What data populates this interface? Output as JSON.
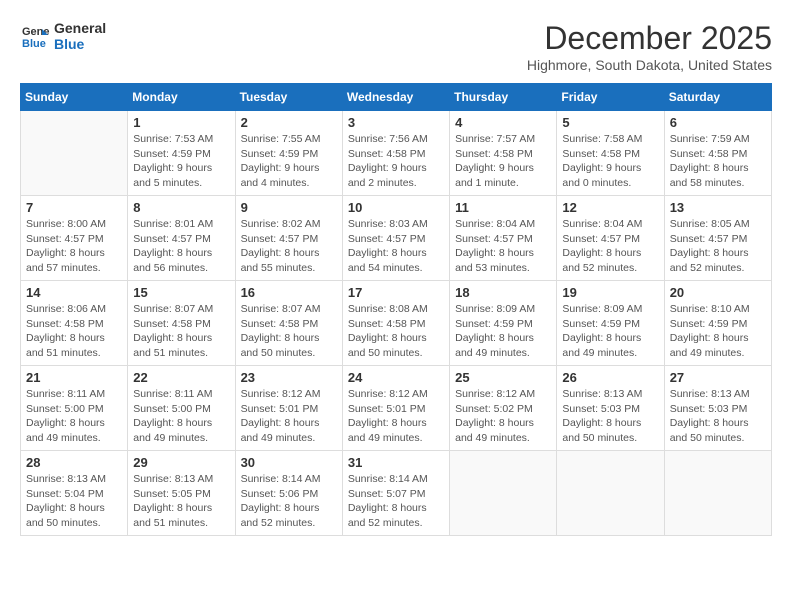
{
  "logo": {
    "line1": "General",
    "line2": "Blue"
  },
  "header": {
    "month": "December 2025",
    "location": "Highmore, South Dakota, United States"
  },
  "weekdays": [
    "Sunday",
    "Monday",
    "Tuesday",
    "Wednesday",
    "Thursday",
    "Friday",
    "Saturday"
  ],
  "weeks": [
    [
      {
        "day": "",
        "content": ""
      },
      {
        "day": "1",
        "content": "Sunrise: 7:53 AM\nSunset: 4:59 PM\nDaylight: 9 hours\nand 5 minutes."
      },
      {
        "day": "2",
        "content": "Sunrise: 7:55 AM\nSunset: 4:59 PM\nDaylight: 9 hours\nand 4 minutes."
      },
      {
        "day": "3",
        "content": "Sunrise: 7:56 AM\nSunset: 4:58 PM\nDaylight: 9 hours\nand 2 minutes."
      },
      {
        "day": "4",
        "content": "Sunrise: 7:57 AM\nSunset: 4:58 PM\nDaylight: 9 hours\nand 1 minute."
      },
      {
        "day": "5",
        "content": "Sunrise: 7:58 AM\nSunset: 4:58 PM\nDaylight: 9 hours\nand 0 minutes."
      },
      {
        "day": "6",
        "content": "Sunrise: 7:59 AM\nSunset: 4:58 PM\nDaylight: 8 hours\nand 58 minutes."
      }
    ],
    [
      {
        "day": "7",
        "content": "Sunrise: 8:00 AM\nSunset: 4:57 PM\nDaylight: 8 hours\nand 57 minutes."
      },
      {
        "day": "8",
        "content": "Sunrise: 8:01 AM\nSunset: 4:57 PM\nDaylight: 8 hours\nand 56 minutes."
      },
      {
        "day": "9",
        "content": "Sunrise: 8:02 AM\nSunset: 4:57 PM\nDaylight: 8 hours\nand 55 minutes."
      },
      {
        "day": "10",
        "content": "Sunrise: 8:03 AM\nSunset: 4:57 PM\nDaylight: 8 hours\nand 54 minutes."
      },
      {
        "day": "11",
        "content": "Sunrise: 8:04 AM\nSunset: 4:57 PM\nDaylight: 8 hours\nand 53 minutes."
      },
      {
        "day": "12",
        "content": "Sunrise: 8:04 AM\nSunset: 4:57 PM\nDaylight: 8 hours\nand 52 minutes."
      },
      {
        "day": "13",
        "content": "Sunrise: 8:05 AM\nSunset: 4:57 PM\nDaylight: 8 hours\nand 52 minutes."
      }
    ],
    [
      {
        "day": "14",
        "content": "Sunrise: 8:06 AM\nSunset: 4:58 PM\nDaylight: 8 hours\nand 51 minutes."
      },
      {
        "day": "15",
        "content": "Sunrise: 8:07 AM\nSunset: 4:58 PM\nDaylight: 8 hours\nand 51 minutes."
      },
      {
        "day": "16",
        "content": "Sunrise: 8:07 AM\nSunset: 4:58 PM\nDaylight: 8 hours\nand 50 minutes."
      },
      {
        "day": "17",
        "content": "Sunrise: 8:08 AM\nSunset: 4:58 PM\nDaylight: 8 hours\nand 50 minutes."
      },
      {
        "day": "18",
        "content": "Sunrise: 8:09 AM\nSunset: 4:59 PM\nDaylight: 8 hours\nand 49 minutes."
      },
      {
        "day": "19",
        "content": "Sunrise: 8:09 AM\nSunset: 4:59 PM\nDaylight: 8 hours\nand 49 minutes."
      },
      {
        "day": "20",
        "content": "Sunrise: 8:10 AM\nSunset: 4:59 PM\nDaylight: 8 hours\nand 49 minutes."
      }
    ],
    [
      {
        "day": "21",
        "content": "Sunrise: 8:11 AM\nSunset: 5:00 PM\nDaylight: 8 hours\nand 49 minutes."
      },
      {
        "day": "22",
        "content": "Sunrise: 8:11 AM\nSunset: 5:00 PM\nDaylight: 8 hours\nand 49 minutes."
      },
      {
        "day": "23",
        "content": "Sunrise: 8:12 AM\nSunset: 5:01 PM\nDaylight: 8 hours\nand 49 minutes."
      },
      {
        "day": "24",
        "content": "Sunrise: 8:12 AM\nSunset: 5:01 PM\nDaylight: 8 hours\nand 49 minutes."
      },
      {
        "day": "25",
        "content": "Sunrise: 8:12 AM\nSunset: 5:02 PM\nDaylight: 8 hours\nand 49 minutes."
      },
      {
        "day": "26",
        "content": "Sunrise: 8:13 AM\nSunset: 5:03 PM\nDaylight: 8 hours\nand 50 minutes."
      },
      {
        "day": "27",
        "content": "Sunrise: 8:13 AM\nSunset: 5:03 PM\nDaylight: 8 hours\nand 50 minutes."
      }
    ],
    [
      {
        "day": "28",
        "content": "Sunrise: 8:13 AM\nSunset: 5:04 PM\nDaylight: 8 hours\nand 50 minutes."
      },
      {
        "day": "29",
        "content": "Sunrise: 8:13 AM\nSunset: 5:05 PM\nDaylight: 8 hours\nand 51 minutes."
      },
      {
        "day": "30",
        "content": "Sunrise: 8:14 AM\nSunset: 5:06 PM\nDaylight: 8 hours\nand 52 minutes."
      },
      {
        "day": "31",
        "content": "Sunrise: 8:14 AM\nSunset: 5:07 PM\nDaylight: 8 hours\nand 52 minutes."
      },
      {
        "day": "",
        "content": ""
      },
      {
        "day": "",
        "content": ""
      },
      {
        "day": "",
        "content": ""
      }
    ]
  ]
}
